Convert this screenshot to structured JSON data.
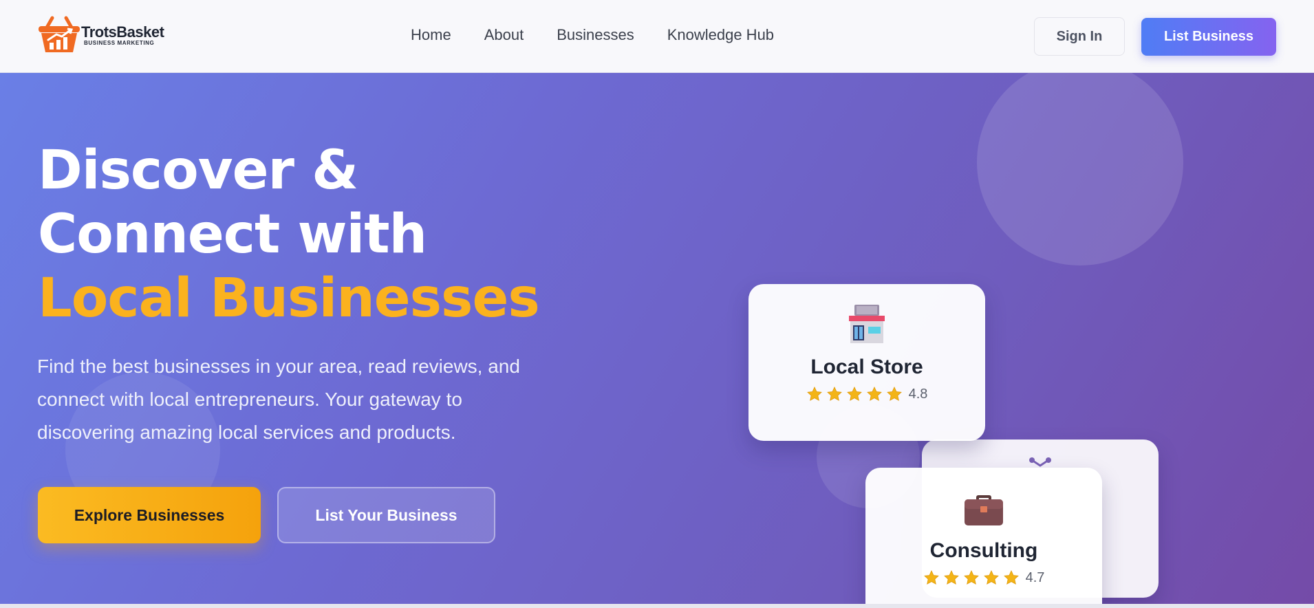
{
  "brand": {
    "name": "TrotsBasket",
    "tagline": "BUSINESS MARKETING",
    "accent_color": "#f06a22"
  },
  "nav": {
    "links": [
      {
        "label": "Home"
      },
      {
        "label": "About"
      },
      {
        "label": "Businesses"
      },
      {
        "label": "Knowledge Hub"
      }
    ],
    "sign_in_label": "Sign In",
    "list_business_label": "List Business"
  },
  "hero": {
    "headline_line1": "Discover &",
    "headline_line2": "Connect with",
    "headline_accent": "Local Businesses",
    "subtitle": "Find the best businesses in your area, read reviews, and connect with local entrepreneurs. Your gateway to discovering amazing local services and products.",
    "primary_cta": "Explore Businesses",
    "secondary_cta": "List Your Business",
    "accent_color": "#fbb21e"
  },
  "cards": [
    {
      "title": "Local Store",
      "rating": "4.8",
      "icon": "convenience-store-icon",
      "stars": 5
    },
    {
      "title": "Consulting",
      "rating": "4.7",
      "icon": "briefcase-icon",
      "stars": 5
    }
  ]
}
